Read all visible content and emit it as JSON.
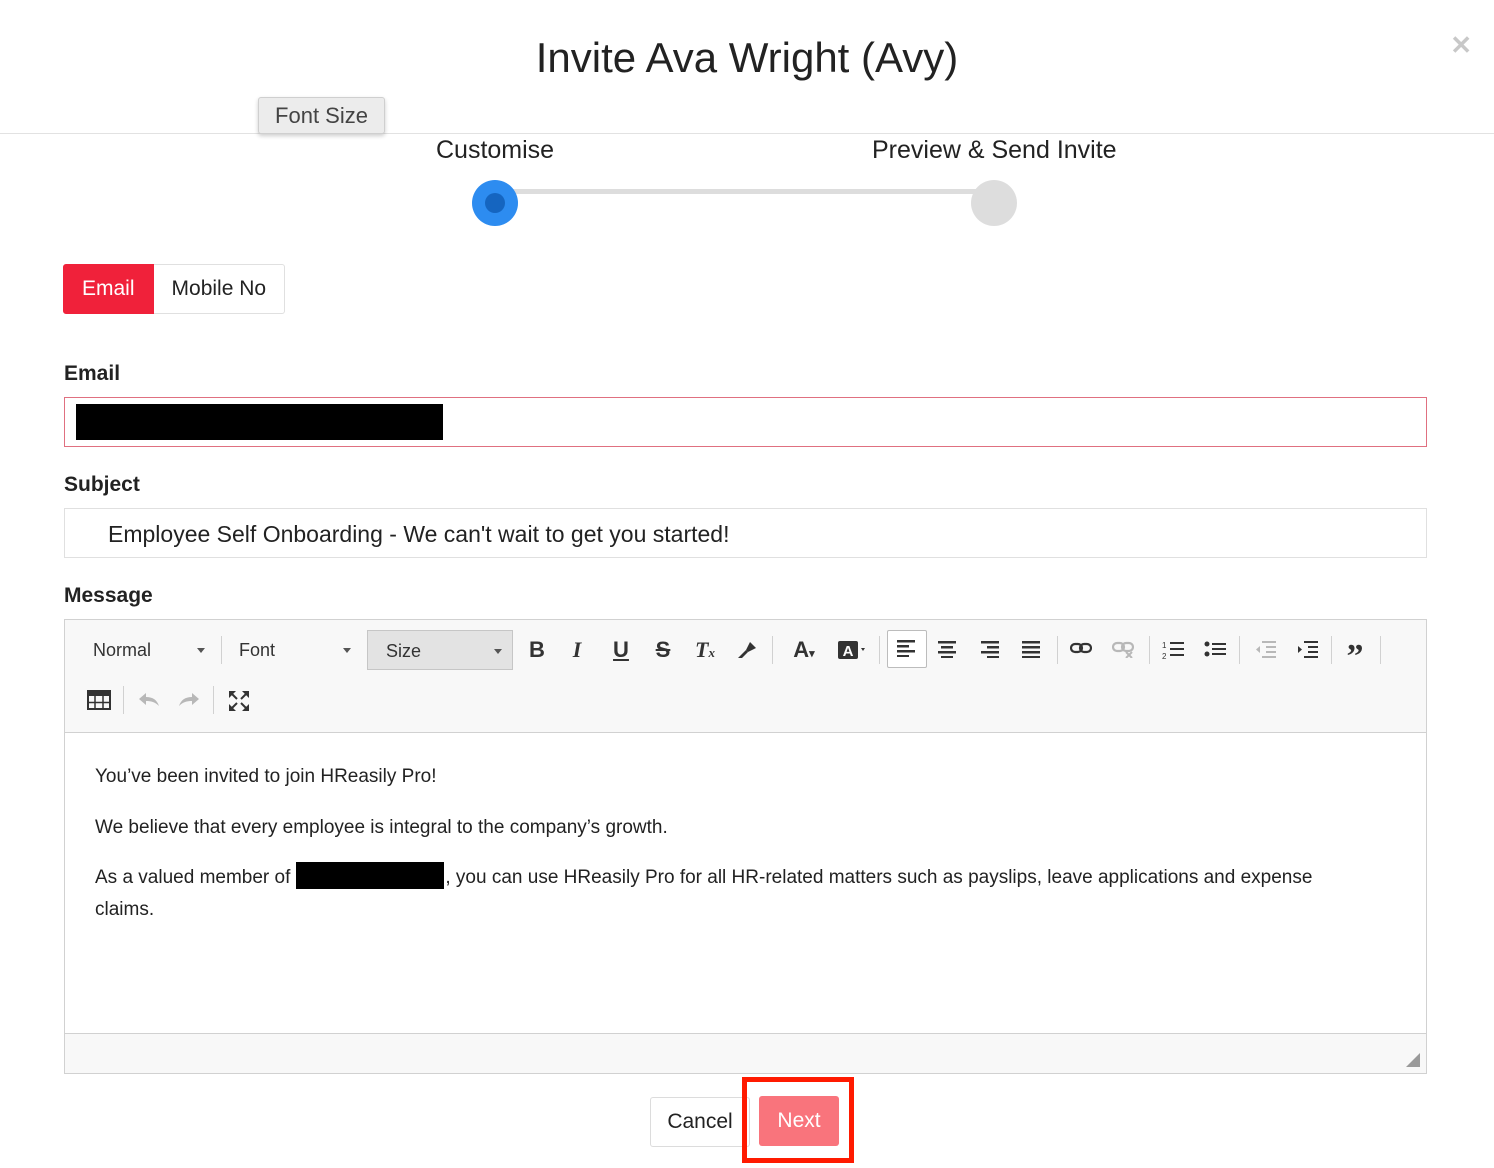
{
  "modal": {
    "title": "Invite Ava Wright (Avy)",
    "close_icon": "close-icon"
  },
  "tooltip": {
    "text": "Font Size"
  },
  "steps": [
    {
      "label": "Customise",
      "state": "active"
    },
    {
      "label": "Preview & Send Invite",
      "state": "pending"
    }
  ],
  "contact_toggle": {
    "options": [
      "Email",
      "Mobile No"
    ],
    "selected": "Email"
  },
  "form": {
    "email_label": "Email",
    "email_value": "[redacted]",
    "subject_label": "Subject",
    "subject_value": "Employee Self Onboarding - We can't wait to get you started!",
    "message_label": "Message"
  },
  "editor": {
    "toolbar": {
      "format": "Normal",
      "font": "Font",
      "size": "Size",
      "buttons": [
        "bold-icon",
        "italic-icon",
        "underline-icon",
        "strikethrough-icon",
        "clear-format-icon",
        "format-painter-icon",
        "text-color-icon",
        "background-color-icon",
        "align-left-icon",
        "align-center-icon",
        "align-right-icon",
        "align-justify-icon",
        "link-icon",
        "unlink-icon",
        "ordered-list-icon",
        "bullet-list-icon",
        "outdent-icon",
        "indent-icon",
        "blockquote-icon",
        "table-icon",
        "undo-icon",
        "redo-icon",
        "fullscreen-icon"
      ]
    },
    "paragraphs": {
      "p1": "You’ve been invited to join HReasily Pro!",
      "p2": "We believe that every employee is integral to the company’s growth.",
      "p3_before": "As a valued member of",
      "p3_after": ", you can use HReasily Pro for all HR-related matters such as payslips, leave applications and expense claims."
    }
  },
  "actions": {
    "cancel": "Cancel",
    "next": "Next"
  },
  "colors": {
    "accent_red": "#f0213a",
    "next_button": "#f9747c",
    "step_active": "#2d8cf0",
    "highlight_outline": "#ff1a00"
  }
}
